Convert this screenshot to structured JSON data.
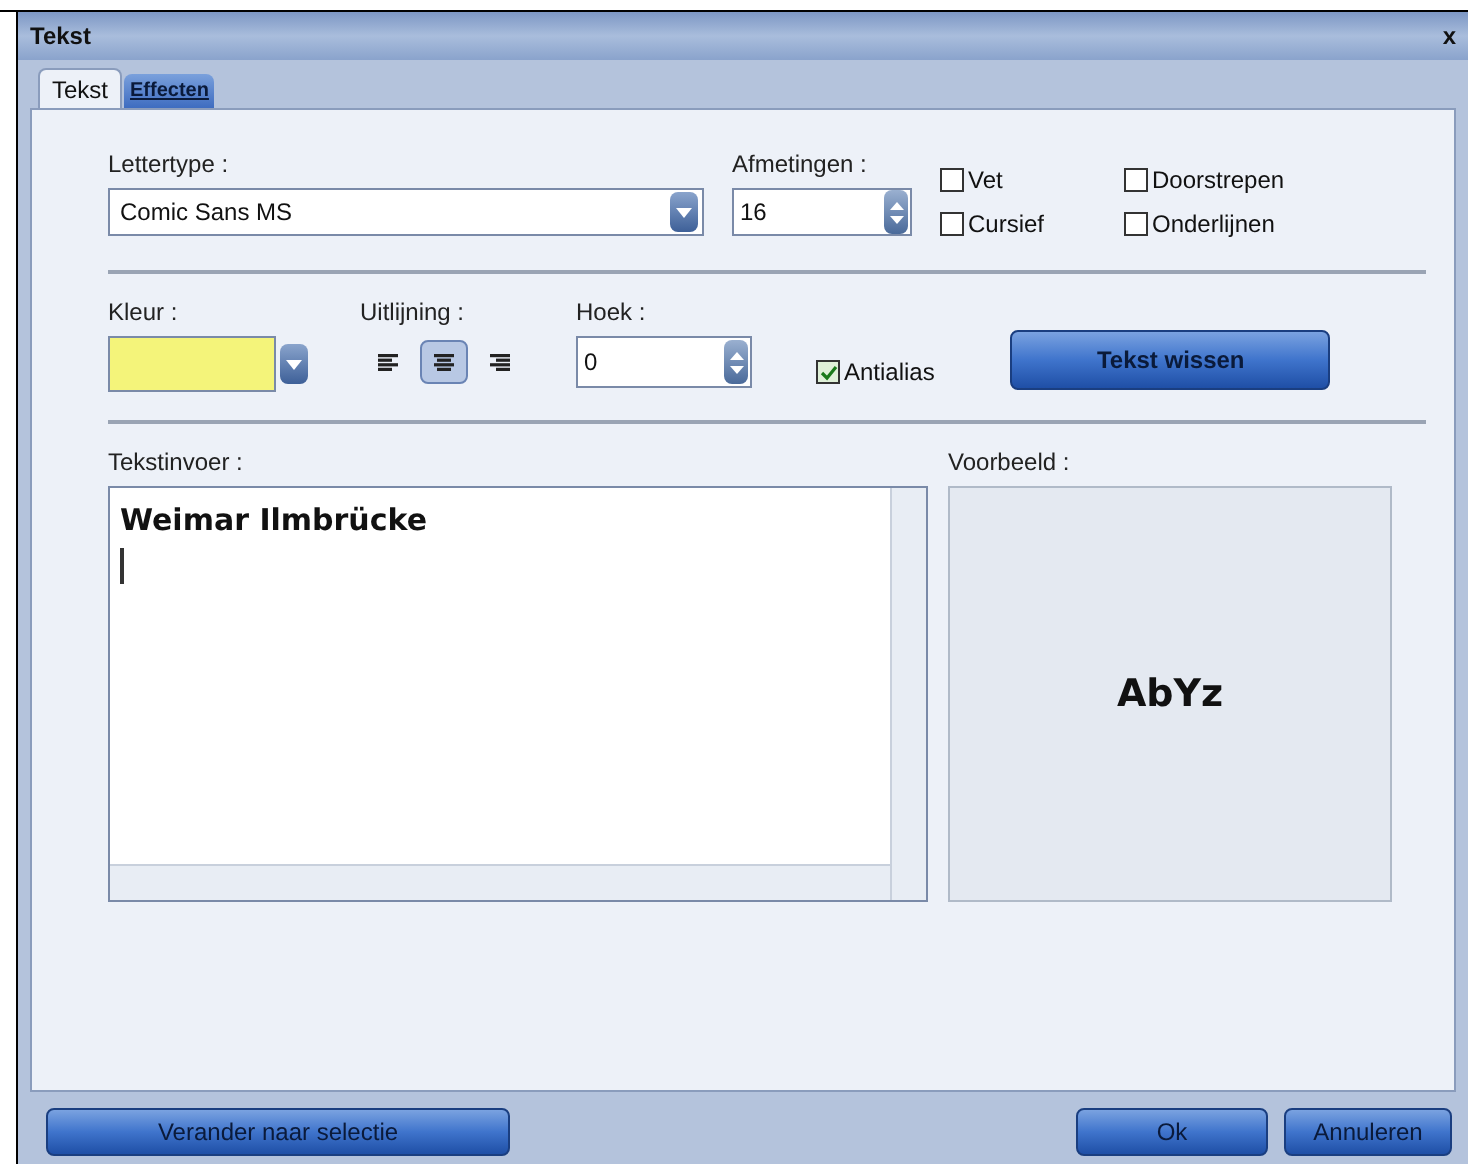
{
  "window": {
    "title": "Tekst",
    "close": "x"
  },
  "tabs": [
    {
      "label": "Tekst",
      "selected": true
    },
    {
      "label": "Effecten",
      "selected": false
    }
  ],
  "font": {
    "label": "Lettertype :",
    "value": "Comic Sans MS"
  },
  "size": {
    "label": "Afmetingen :",
    "value": "16"
  },
  "styles": [
    {
      "label": "Vet",
      "checked": false
    },
    {
      "label": "Doorstrepen",
      "checked": false
    },
    {
      "label": "Cursief",
      "checked": false
    },
    {
      "label": "Onderlijnen",
      "checked": false
    }
  ],
  "color": {
    "label": "Kleur :",
    "color": "#f4f47a"
  },
  "alignment": {
    "label": "Uitlijning :",
    "options": [
      {
        "kind": "left",
        "selected": false
      },
      {
        "kind": "center",
        "selected": true
      },
      {
        "kind": "right",
        "selected": false
      }
    ]
  },
  "angle": {
    "label": "Hoek :",
    "value": "0"
  },
  "antialias": {
    "label": "Antialias",
    "checked": true
  },
  "clear_button": "Tekst wissen",
  "input": {
    "label": "Tekstinvoer :",
    "value": "Weimar Ilmbrücke"
  },
  "preview": {
    "label": "Voorbeeld :",
    "sample": "AbYz"
  },
  "buttons": {
    "apply": "Verander naar selectie",
    "ok": "Ok",
    "cancel": "Annuleren"
  }
}
